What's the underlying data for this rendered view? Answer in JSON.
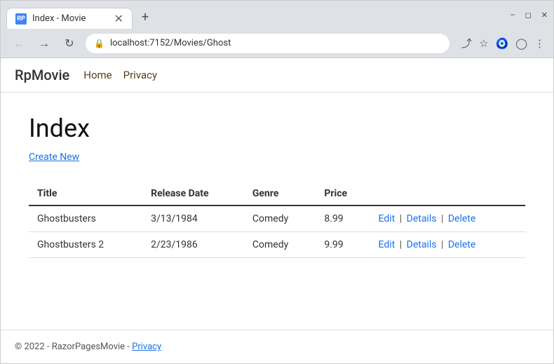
{
  "browser": {
    "tab_title": "Index - Movie",
    "tab_favicon": "RP",
    "url": "localhost:7152/Movies/Ghost",
    "new_tab_icon": "+",
    "win_min": "−",
    "win_max": "□",
    "win_close": "✕",
    "win_restore": "❐"
  },
  "nav": {
    "brand": "RpMovie",
    "links": [
      {
        "label": "Home",
        "href": "#"
      },
      {
        "label": "Privacy",
        "href": "#"
      }
    ]
  },
  "main": {
    "heading": "Index",
    "create_new_label": "Create New",
    "table": {
      "columns": [
        "Title",
        "Release Date",
        "Genre",
        "Price"
      ],
      "rows": [
        {
          "title": "Ghostbusters",
          "release_date": "3/13/1984",
          "genre": "Comedy",
          "price": "8.99"
        },
        {
          "title": "Ghostbusters 2",
          "release_date": "2/23/1986",
          "genre": "Comedy",
          "price": "9.99"
        }
      ],
      "actions": [
        "Edit",
        "Details",
        "Delete"
      ]
    }
  },
  "footer": {
    "copyright": "© 2022 - RazorPagesMovie - ",
    "privacy_label": "Privacy"
  }
}
